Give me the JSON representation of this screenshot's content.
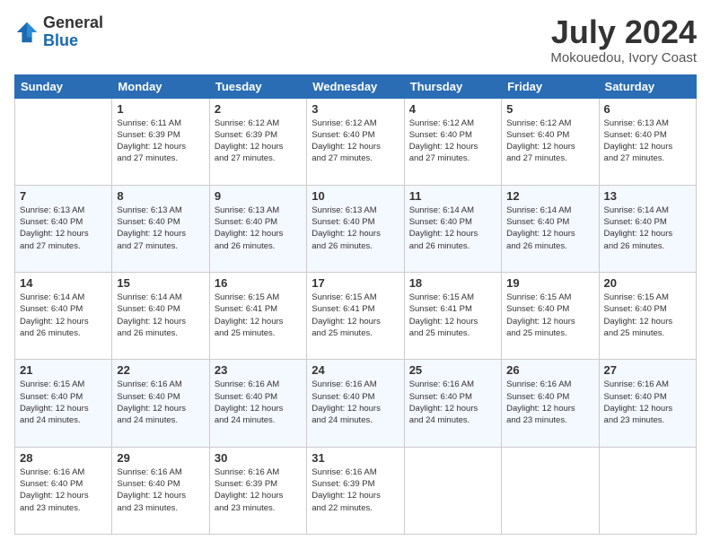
{
  "header": {
    "logo": {
      "general": "General",
      "blue": "Blue"
    },
    "title": "July 2024",
    "subtitle": "Mokouedou, Ivory Coast"
  },
  "calendar": {
    "days_of_week": [
      "Sunday",
      "Monday",
      "Tuesday",
      "Wednesday",
      "Thursday",
      "Friday",
      "Saturday"
    ],
    "weeks": [
      [
        {
          "num": "",
          "info": ""
        },
        {
          "num": "1",
          "info": "Sunrise: 6:11 AM\nSunset: 6:39 PM\nDaylight: 12 hours\nand 27 minutes."
        },
        {
          "num": "2",
          "info": "Sunrise: 6:12 AM\nSunset: 6:39 PM\nDaylight: 12 hours\nand 27 minutes."
        },
        {
          "num": "3",
          "info": "Sunrise: 6:12 AM\nSunset: 6:40 PM\nDaylight: 12 hours\nand 27 minutes."
        },
        {
          "num": "4",
          "info": "Sunrise: 6:12 AM\nSunset: 6:40 PM\nDaylight: 12 hours\nand 27 minutes."
        },
        {
          "num": "5",
          "info": "Sunrise: 6:12 AM\nSunset: 6:40 PM\nDaylight: 12 hours\nand 27 minutes."
        },
        {
          "num": "6",
          "info": "Sunrise: 6:13 AM\nSunset: 6:40 PM\nDaylight: 12 hours\nand 27 minutes."
        }
      ],
      [
        {
          "num": "7",
          "info": "Sunrise: 6:13 AM\nSunset: 6:40 PM\nDaylight: 12 hours\nand 27 minutes."
        },
        {
          "num": "8",
          "info": "Sunrise: 6:13 AM\nSunset: 6:40 PM\nDaylight: 12 hours\nand 27 minutes."
        },
        {
          "num": "9",
          "info": "Sunrise: 6:13 AM\nSunset: 6:40 PM\nDaylight: 12 hours\nand 26 minutes."
        },
        {
          "num": "10",
          "info": "Sunrise: 6:13 AM\nSunset: 6:40 PM\nDaylight: 12 hours\nand 26 minutes."
        },
        {
          "num": "11",
          "info": "Sunrise: 6:14 AM\nSunset: 6:40 PM\nDaylight: 12 hours\nand 26 minutes."
        },
        {
          "num": "12",
          "info": "Sunrise: 6:14 AM\nSunset: 6:40 PM\nDaylight: 12 hours\nand 26 minutes."
        },
        {
          "num": "13",
          "info": "Sunrise: 6:14 AM\nSunset: 6:40 PM\nDaylight: 12 hours\nand 26 minutes."
        }
      ],
      [
        {
          "num": "14",
          "info": "Sunrise: 6:14 AM\nSunset: 6:40 PM\nDaylight: 12 hours\nand 26 minutes."
        },
        {
          "num": "15",
          "info": "Sunrise: 6:14 AM\nSunset: 6:40 PM\nDaylight: 12 hours\nand 26 minutes."
        },
        {
          "num": "16",
          "info": "Sunrise: 6:15 AM\nSunset: 6:41 PM\nDaylight: 12 hours\nand 25 minutes."
        },
        {
          "num": "17",
          "info": "Sunrise: 6:15 AM\nSunset: 6:41 PM\nDaylight: 12 hours\nand 25 minutes."
        },
        {
          "num": "18",
          "info": "Sunrise: 6:15 AM\nSunset: 6:41 PM\nDaylight: 12 hours\nand 25 minutes."
        },
        {
          "num": "19",
          "info": "Sunrise: 6:15 AM\nSunset: 6:40 PM\nDaylight: 12 hours\nand 25 minutes."
        },
        {
          "num": "20",
          "info": "Sunrise: 6:15 AM\nSunset: 6:40 PM\nDaylight: 12 hours\nand 25 minutes."
        }
      ],
      [
        {
          "num": "21",
          "info": "Sunrise: 6:15 AM\nSunset: 6:40 PM\nDaylight: 12 hours\nand 24 minutes."
        },
        {
          "num": "22",
          "info": "Sunrise: 6:16 AM\nSunset: 6:40 PM\nDaylight: 12 hours\nand 24 minutes."
        },
        {
          "num": "23",
          "info": "Sunrise: 6:16 AM\nSunset: 6:40 PM\nDaylight: 12 hours\nand 24 minutes."
        },
        {
          "num": "24",
          "info": "Sunrise: 6:16 AM\nSunset: 6:40 PM\nDaylight: 12 hours\nand 24 minutes."
        },
        {
          "num": "25",
          "info": "Sunrise: 6:16 AM\nSunset: 6:40 PM\nDaylight: 12 hours\nand 24 minutes."
        },
        {
          "num": "26",
          "info": "Sunrise: 6:16 AM\nSunset: 6:40 PM\nDaylight: 12 hours\nand 23 minutes."
        },
        {
          "num": "27",
          "info": "Sunrise: 6:16 AM\nSunset: 6:40 PM\nDaylight: 12 hours\nand 23 minutes."
        }
      ],
      [
        {
          "num": "28",
          "info": "Sunrise: 6:16 AM\nSunset: 6:40 PM\nDaylight: 12 hours\nand 23 minutes."
        },
        {
          "num": "29",
          "info": "Sunrise: 6:16 AM\nSunset: 6:40 PM\nDaylight: 12 hours\nand 23 minutes."
        },
        {
          "num": "30",
          "info": "Sunrise: 6:16 AM\nSunset: 6:39 PM\nDaylight: 12 hours\nand 23 minutes."
        },
        {
          "num": "31",
          "info": "Sunrise: 6:16 AM\nSunset: 6:39 PM\nDaylight: 12 hours\nand 22 minutes."
        },
        {
          "num": "",
          "info": ""
        },
        {
          "num": "",
          "info": ""
        },
        {
          "num": "",
          "info": ""
        }
      ]
    ]
  }
}
